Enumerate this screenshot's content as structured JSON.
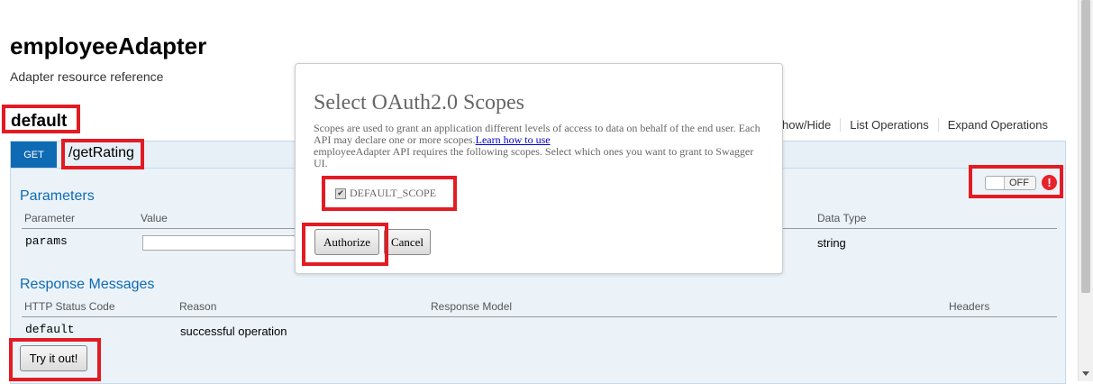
{
  "page": {
    "title": "employeeAdapter",
    "subtitle": "Adapter resource reference"
  },
  "resource": {
    "name": "default",
    "actions": [
      "Show/Hide",
      "List Operations",
      "Expand Operations"
    ]
  },
  "operation": {
    "method": "GET",
    "path": "/getRating",
    "toggle_label": "OFF",
    "alert_symbol": "!",
    "parameters": {
      "title": "Parameters",
      "headers": [
        "Parameter",
        "Value",
        "Data Type"
      ],
      "rows": [
        {
          "name": "params",
          "value": "",
          "data_type": "string"
        }
      ]
    },
    "responses": {
      "title": "Response Messages",
      "headers": [
        "HTTP Status Code",
        "Reason",
        "Response Model",
        "Headers"
      ],
      "rows": [
        {
          "code": "default",
          "reason": "successful operation"
        }
      ]
    },
    "try_button": "Try it out!"
  },
  "modal": {
    "title": "Select OAuth2.0 Scopes",
    "description": "Scopes are used to grant an application different levels of access to data on behalf of the end user. Each API may declare one or more scopes.",
    "learn_link": "Learn how to use",
    "requirement": "employeeAdapter API requires the following scopes. Select which ones you want to grant to Swagger UI.",
    "scope": {
      "label": "DEFAULT_SCOPE",
      "checked": true
    },
    "authorize_button": "Authorize",
    "cancel_button": "Cancel"
  },
  "colors": {
    "accent": "#0f6ab4",
    "highlight": "#e31b23",
    "alert": "#e8222a"
  }
}
